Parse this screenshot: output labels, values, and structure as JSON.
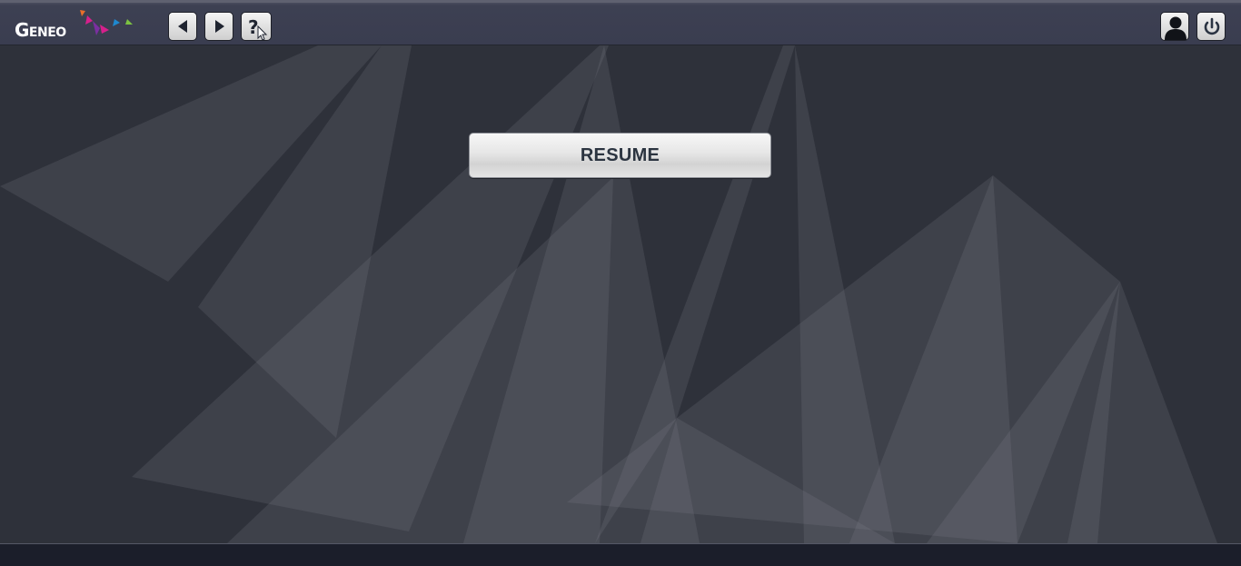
{
  "header": {
    "logo_text": "Geneo",
    "back_icon": "triangle-left-icon",
    "forward_icon": "triangle-right-icon",
    "help_icon": "question-cursor-icon",
    "user_icon": "user-silhouette-icon",
    "power_icon": "power-icon"
  },
  "main": {
    "resume_label": "RESUME"
  },
  "colors": {
    "topbar": "#3c3f51",
    "background": "#2e313a",
    "footer": "#1b1e2a",
    "button_text": "#2b3440",
    "logo_orange": "#e8702a",
    "logo_magenta": "#d6208c",
    "logo_purple": "#7a2fa0",
    "logo_blue": "#1e88d0",
    "logo_green": "#7cc242"
  }
}
